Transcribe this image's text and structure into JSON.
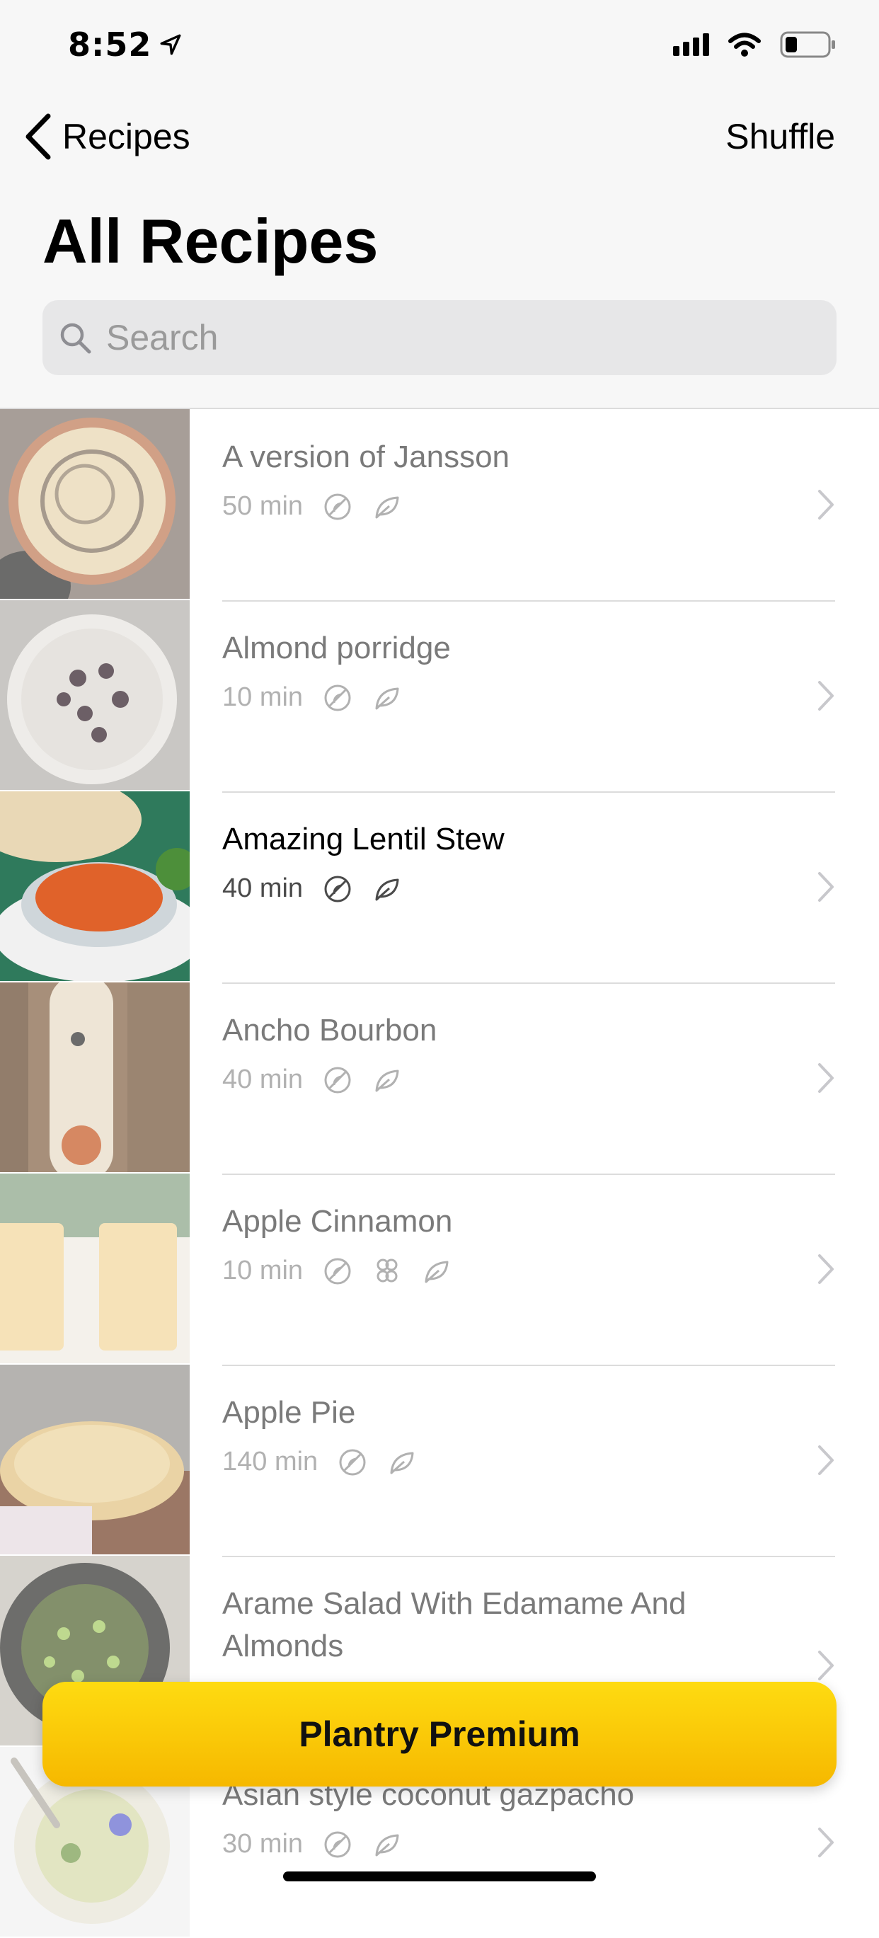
{
  "status_bar": {
    "time": "8:52",
    "icons": [
      "location-arrow-icon",
      "signal-icon",
      "wifi-icon",
      "battery-icon"
    ]
  },
  "nav": {
    "back_label": "Recipes",
    "shuffle_label": "Shuffle"
  },
  "page_title": "All Recipes",
  "search": {
    "placeholder": "Search",
    "value": ""
  },
  "recipes": [
    {
      "title": "A version of Jansson",
      "time": "50 min",
      "tags": [
        "gluten-free-icon",
        "vegan-leaf-icon"
      ]
    },
    {
      "title": "Almond porridge",
      "time": "10 min",
      "tags": [
        "gluten-free-icon",
        "vegan-leaf-icon"
      ]
    },
    {
      "title": "Amazing Lentil Stew",
      "time": "40 min",
      "tags": [
        "gluten-free-icon",
        "vegan-leaf-icon"
      ],
      "active": true
    },
    {
      "title": "Ancho Bourbon",
      "time": "40 min",
      "tags": [
        "gluten-free-icon",
        "vegan-leaf-icon"
      ]
    },
    {
      "title": "Apple Cinnamon",
      "time": "10 min",
      "tags": [
        "gluten-free-icon",
        "nut-icon",
        "vegan-leaf-icon"
      ]
    },
    {
      "title": "Apple Pie",
      "time": "140 min",
      "tags": [
        "gluten-free-icon",
        "vegan-leaf-icon"
      ]
    },
    {
      "title": "Arame Salad With Edamame And Almonds",
      "time": "",
      "tags": []
    },
    {
      "title": "Asian style coconut gazpacho",
      "time": "30 min",
      "tags": [
        "gluten-free-icon",
        "vegan-leaf-icon"
      ]
    }
  ],
  "premium_button": {
    "label": "Plantry Premium"
  },
  "colors": {
    "accent": "#fdcf00",
    "muted_text": "#7a7a7a",
    "meta_text": "#b1b1b1"
  }
}
